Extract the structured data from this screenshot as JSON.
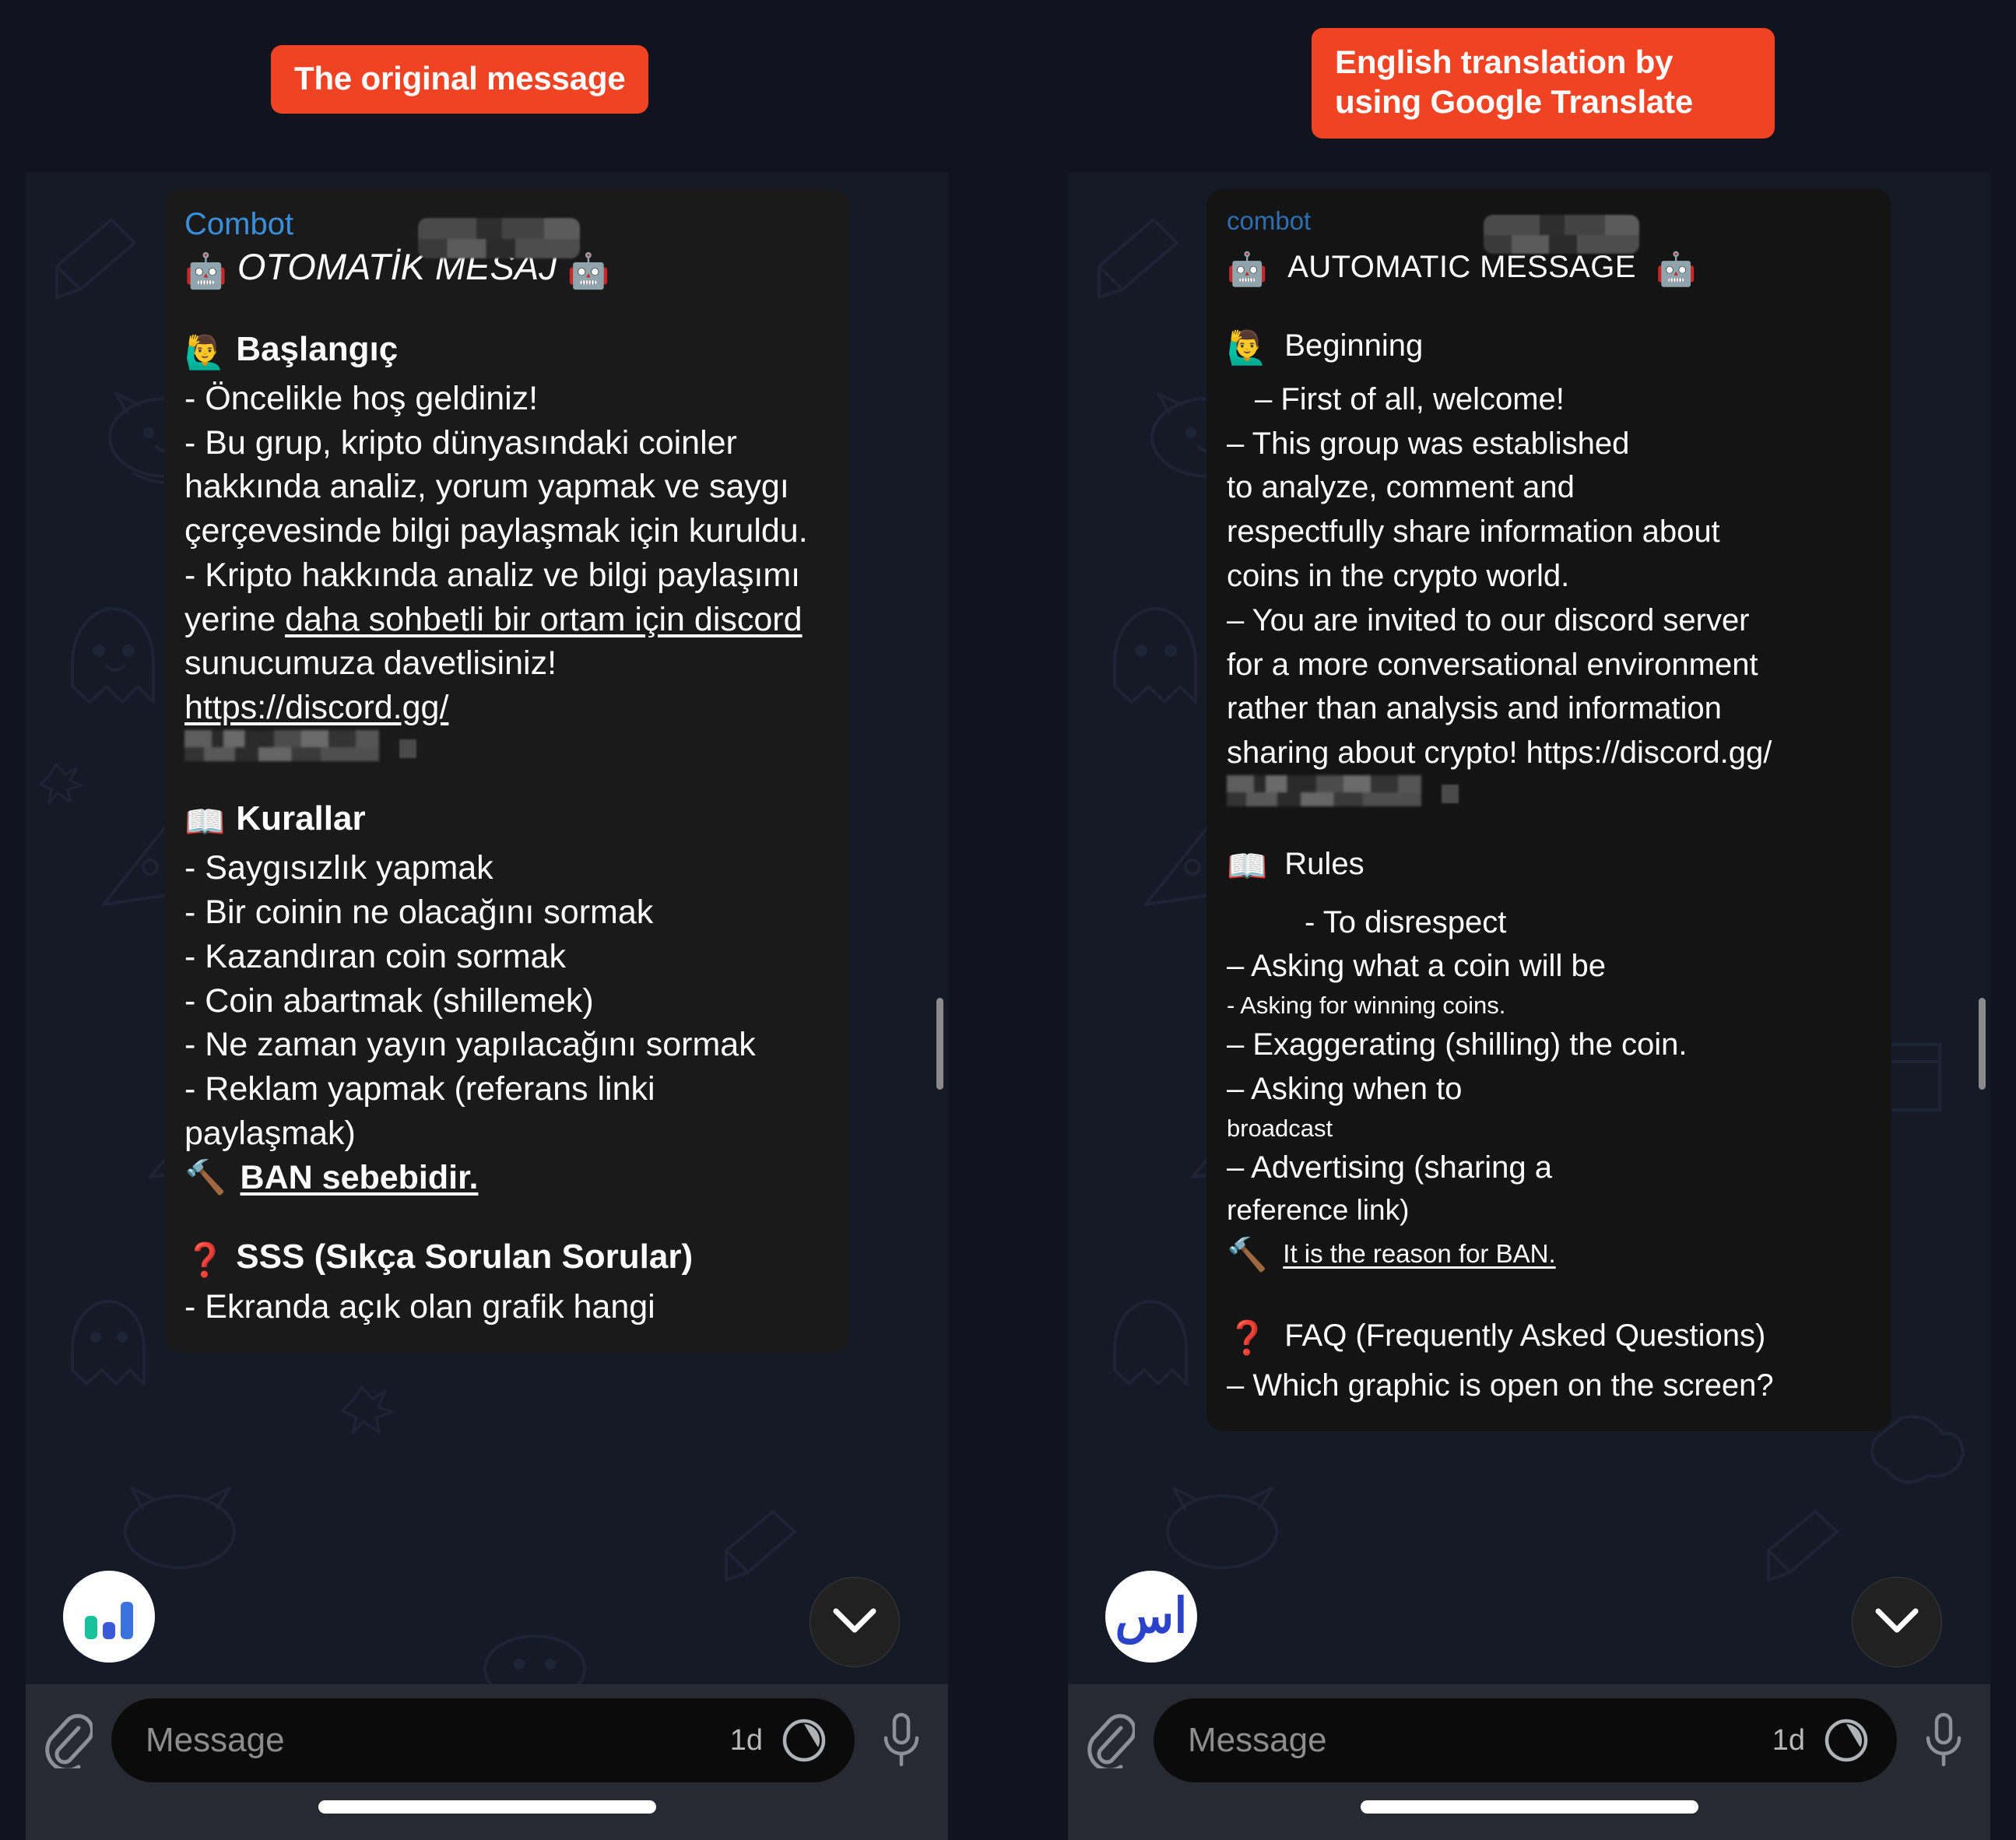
{
  "annotations": {
    "left_label": "The original message",
    "right_label": "English translation by using Google Translate",
    "accent_color": "#f04323"
  },
  "left_panel": {
    "sender": "Combot",
    "redacted_username": "",
    "title_emoji_left": "🤖",
    "title": "OTOMATİK MESAJ",
    "title_emoji_right": "🤖",
    "sections": [
      {
        "emoji": "🙋‍♂️",
        "heading": "Başlangıç",
        "lines": [
          "- Öncelikle hoş geldiniz!",
          "- Bu grup, kripto dünyasındaki coinler hakkında analiz, yorum yapmak ve saygı çerçevesinde bilgi paylaşmak için kuruldu.",
          "- Kripto hakkında analiz ve bilgi paylaşımı yerine daha sohbetli bir ortam için discord sunucumuza davetlisiniz! https://discord.gg/"
        ],
        "link_underlined_part": "daha sohbetli bir ortam için discord",
        "url": "https://discord.gg/"
      },
      {
        "emoji": "📖",
        "heading": "Kurallar",
        "lines": [
          "- Saygısızlık yapmak",
          "- Bir coinin ne olacağını sormak",
          "- Kazandıran coin sormak",
          "- Coin abartmak (shillemek)",
          "- Ne zaman yayın yapılacağını sormak",
          "- Reklam yapmak (referans linki paylaşmak)"
        ],
        "footer_emoji": "🔨",
        "footer": "BAN sebebidir."
      },
      {
        "emoji": "❓",
        "heading": "SSS (Sıkça Sorulan Sorular)",
        "lines": [
          "- Ekranda açık olan grafik hangi"
        ]
      }
    ],
    "avatar_icon": "bar-chart-icon"
  },
  "right_panel": {
    "sender": "combot",
    "redacted_username": "",
    "title_emoji_left": "🤖",
    "title": "AUTOMATIC MESSAGE",
    "title_emoji_right": "🤖",
    "sections": [
      {
        "emoji": "🙋‍♂️",
        "heading": "Beginning",
        "lines": [
          "–    First of all, welcome!",
          "– This group was established",
          "to analyze, comment and",
          "respectfully share information about",
          "coins in the crypto world.",
          "– You are invited to our discord server",
          "for a more conversational environment",
          "rather than analysis and information",
          "sharing about crypto! https://discord.gg/"
        ]
      },
      {
        "emoji": "📖",
        "heading": "Rules",
        "lines": [
          "- To disrespect",
          "–      Asking what a coin will be",
          "- Asking for winning coins.",
          "– Exaggerating (shilling) the coin.",
          "– Asking when to",
          "broadcast",
          "– Advertising (sharing a",
          "reference link)"
        ],
        "footer_emoji": "🔨",
        "footer": "It is the reason for BAN."
      },
      {
        "emoji": "❓",
        "heading": "FAQ (Frequently Asked Questions)",
        "lines": [
          "–  Which graphic is open on the screen?"
        ]
      }
    ],
    "avatar_text": "اس"
  },
  "composer": {
    "attach_icon": "paperclip-icon",
    "placeholder": "Message",
    "timer_label": "1d",
    "timer_icon": "self-destruct-timer-icon",
    "mic_icon": "microphone-icon"
  },
  "scroll_button": {
    "icon": "chevron-down-icon"
  }
}
